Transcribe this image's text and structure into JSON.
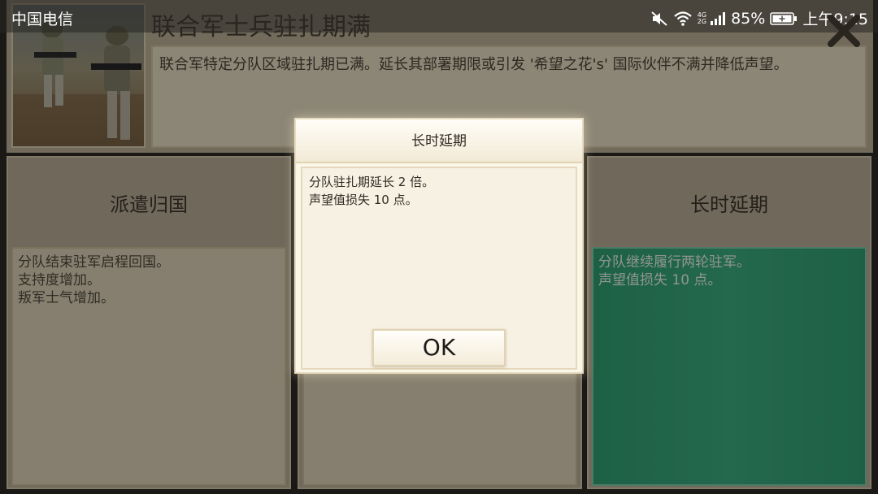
{
  "status_bar": {
    "carrier": "中国电信",
    "network_label_top": "4G",
    "network_label_bottom": "2G",
    "battery": "85%",
    "time": "上午9:15"
  },
  "event": {
    "title": "联合军士兵驻扎期满",
    "description": "联合军特定分队区域驻扎期已满。延长其部署期限或引发 '希望之花's' 国际伙伴不满并降低声望。"
  },
  "options": [
    {
      "title": "派遣归国",
      "description": "分队结束驻军启程回国。\n支持度增加。\n叛军士气增加。"
    },
    {
      "title": "",
      "description": ""
    },
    {
      "title": "长时延期",
      "description": "分队继续履行两轮驻军。\n声望值损失 10 点。"
    }
  ],
  "modal": {
    "title": "长时延期",
    "body": "分队驻扎期延长 2 倍。\n声望值损失 10 点。",
    "ok_label": "OK"
  },
  "colors": {
    "selected_option": "#3aa87d",
    "panel": "#b5a991",
    "modal_bg": "#fbf6ea"
  },
  "icons": [
    "mute-icon",
    "wifi-icon",
    "signal-icon",
    "battery-icon",
    "close-icon"
  ]
}
